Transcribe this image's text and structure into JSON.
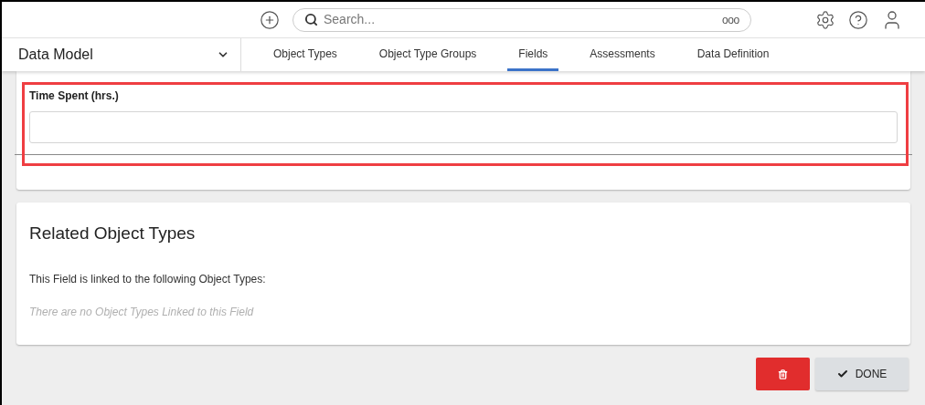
{
  "header": {
    "search": {
      "placeholder": "Search...",
      "more": "ooo"
    }
  },
  "nav": {
    "section": "Data Model",
    "tabs": [
      {
        "label": "Object Types",
        "selected": false
      },
      {
        "label": "Object Type Groups",
        "selected": false
      },
      {
        "label": "Fields",
        "selected": true
      },
      {
        "label": "Assessments",
        "selected": false
      },
      {
        "label": "Data Definition",
        "selected": false
      }
    ]
  },
  "field": {
    "label": "Time Spent (hrs.)"
  },
  "related": {
    "title": "Related Object Types",
    "description": "This Field is linked to the following Object Types:",
    "empty": "There are no Object Types Linked to this Field"
  },
  "actions": {
    "done": "DONE"
  }
}
